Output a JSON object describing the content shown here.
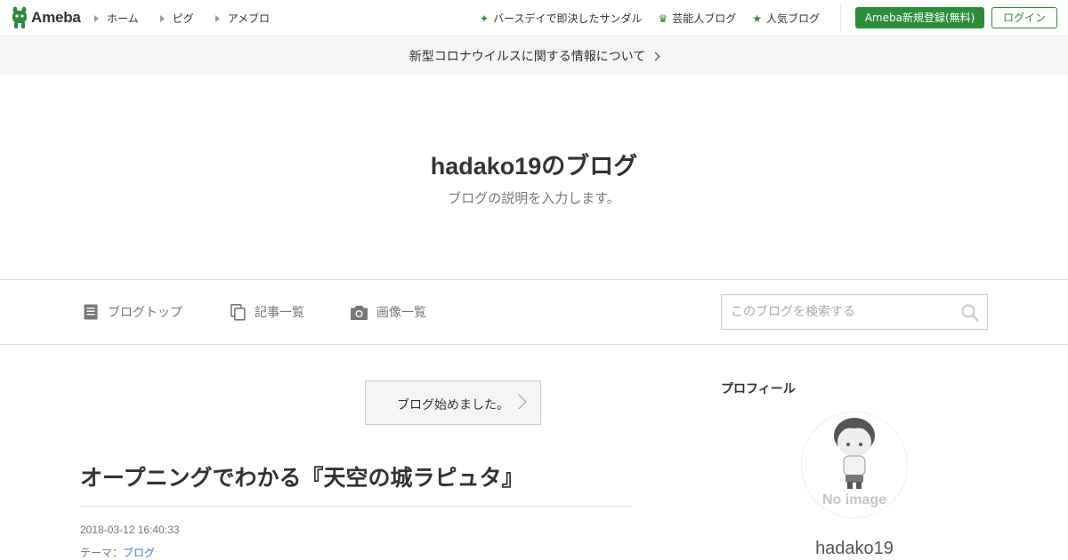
{
  "global_header": {
    "logo_text": "Ameba",
    "nav": [
      {
        "label": "ホーム",
        "icon": "triangle-right-icon"
      },
      {
        "label": "ピグ",
        "icon": "triangle-right-icon"
      },
      {
        "label": "アメブロ",
        "icon": "triangle-right-icon"
      }
    ],
    "links": [
      {
        "label": "バースデイで即決したサンダル",
        "icon": "sparkle-icon"
      },
      {
        "label": "芸能人ブログ",
        "icon": "crown-icon"
      },
      {
        "label": "人気ブログ",
        "icon": "star-icon"
      }
    ],
    "register_label": "Ameba新規登録(無料)",
    "login_label": "ログイン",
    "accent_color": "#2d8c3c"
  },
  "notice": {
    "label": "新型コロナウイルスに関する情報について"
  },
  "blog": {
    "title": "hadako19のブログ",
    "description": "ブログの説明を入力します。"
  },
  "blog_nav": {
    "items": [
      {
        "label": "ブログトップ",
        "icon": "document-icon"
      },
      {
        "label": "記事一覧",
        "icon": "copy-icon"
      },
      {
        "label": "画像一覧",
        "icon": "camera-icon"
      }
    ],
    "search_placeholder": "このブログを検索する"
  },
  "entry": {
    "theme_nav_label": "ブログ始めました。",
    "title": "オープニングでわかる『天空の城ラピュタ』",
    "date": "2018-03-12 16:40:33",
    "theme_prefix": "テーマ：",
    "theme_link": "ブログ",
    "link_color": "#3b7dc4"
  },
  "sidebar": {
    "heading": "プロフィール",
    "avatar_text": "No image",
    "profile_name": "hadako19"
  }
}
